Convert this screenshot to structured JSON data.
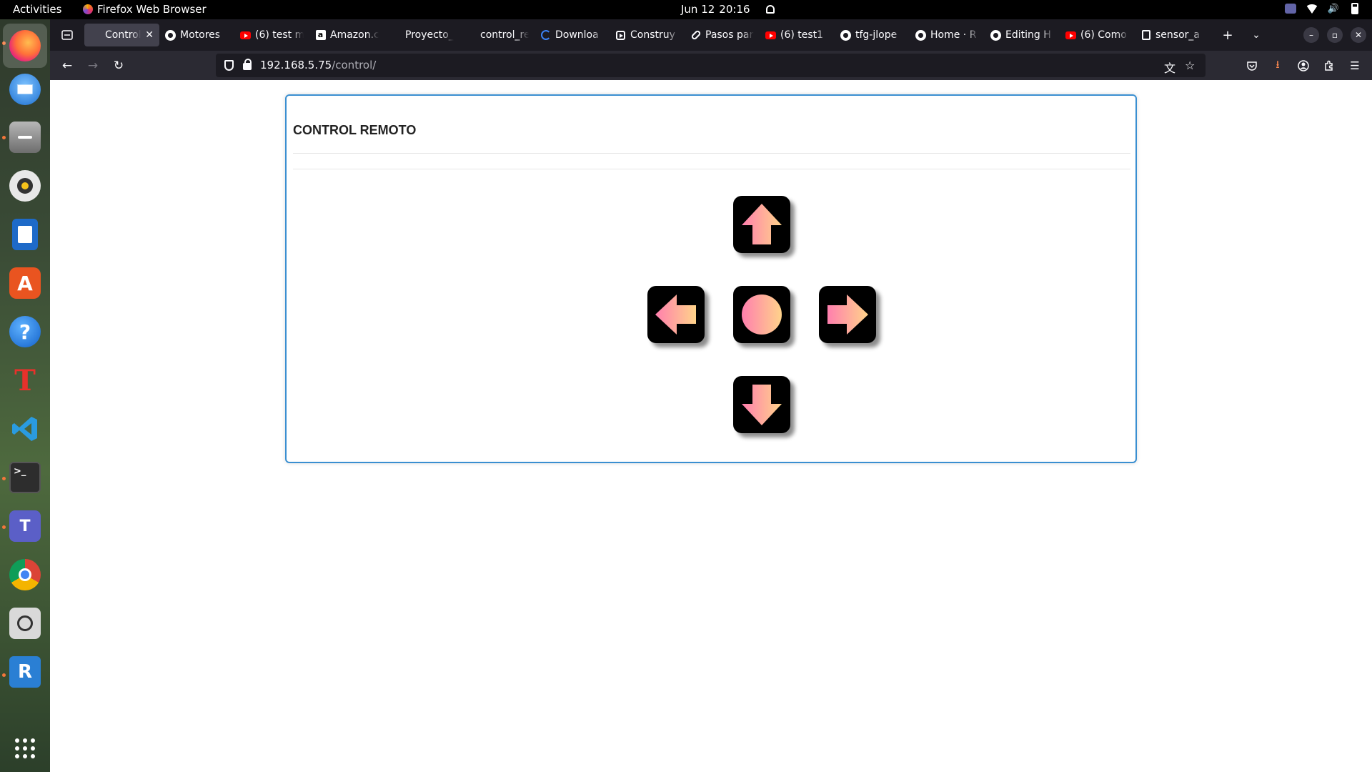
{
  "topbar": {
    "activities": "Activities",
    "app_name": "Firefox Web Browser",
    "date": "Jun 12",
    "time": "20:16"
  },
  "dock": {
    "apps": [
      "firefox-icon",
      "thunderbird-icon",
      "files-icon",
      "rhythmbox-icon",
      "writer-icon",
      "app-center-icon",
      "help-icon",
      "typora-icon",
      "vscode-icon",
      "terminal-icon",
      "teams-icon",
      "chrome-icon",
      "image-viewer-icon",
      "remmina-icon",
      "show-apps-icon"
    ]
  },
  "browser": {
    "tabs": [
      {
        "title": "Control Re",
        "favicon": "blank-icon",
        "active": true
      },
      {
        "title": "Motores",
        "favicon": "github-icon"
      },
      {
        "title": "(6) test m",
        "favicon": "youtube-icon"
      },
      {
        "title": "Amazon.c",
        "favicon": "amazon-icon"
      },
      {
        "title": "Proyecto_ra",
        "favicon": "blank-icon"
      },
      {
        "title": "control_rem",
        "favicon": "blank-icon"
      },
      {
        "title": "Downloa",
        "favicon": "download-icon"
      },
      {
        "title": "Construy",
        "favicon": "play-icon"
      },
      {
        "title": "Pasos par",
        "favicon": "link-icon"
      },
      {
        "title": "(6) test1",
        "favicon": "youtube-icon"
      },
      {
        "title": "tfg-jlope",
        "favicon": "github-icon"
      },
      {
        "title": "Home · R",
        "favicon": "github-icon"
      },
      {
        "title": "Editing H",
        "favicon": "github-icon"
      },
      {
        "title": "(6) Como",
        "favicon": "youtube-icon"
      },
      {
        "title": "sensor_a",
        "favicon": "doc-icon"
      }
    ],
    "new_tab": "+",
    "url_host": "192.168.5.75",
    "url_path": "/control/"
  },
  "page": {
    "title": "CONTROL REMOTO",
    "buttons": [
      "up",
      "left",
      "stop",
      "right",
      "down"
    ]
  },
  "colors": {
    "panel_border": "#3a8fd1",
    "gradient_start": "#ff7fae",
    "gradient_end": "#ffd38a",
    "button_bg": "#000000"
  }
}
